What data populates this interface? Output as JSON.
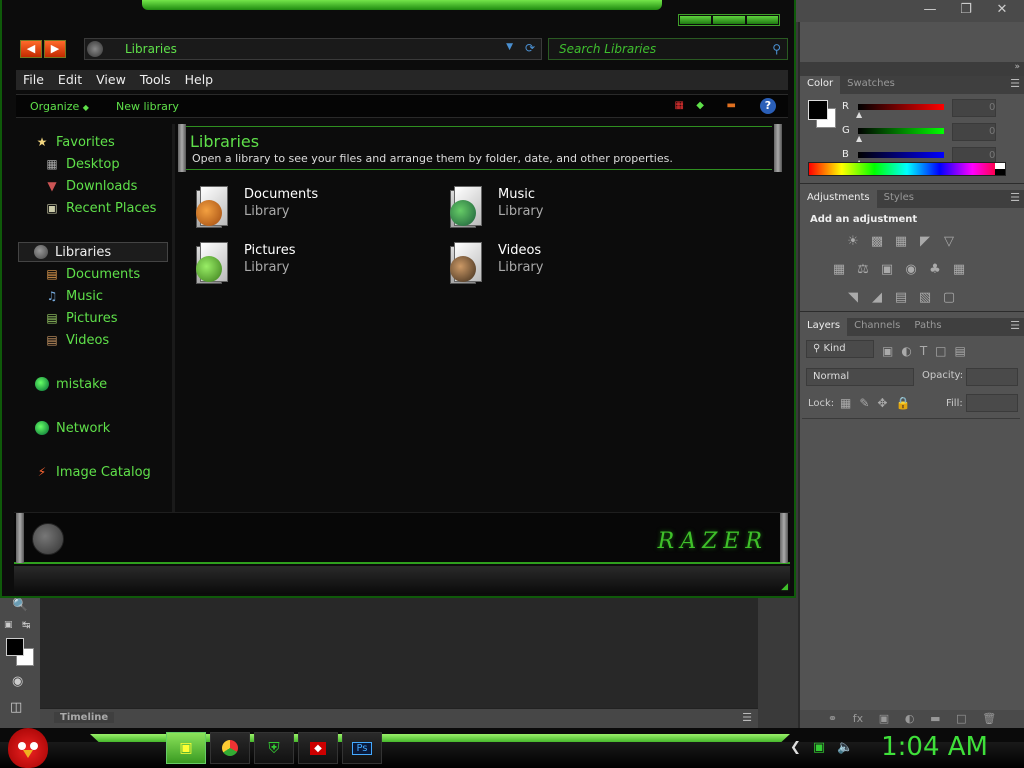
{
  "explorer": {
    "address": "Libraries",
    "search_placeholder": "Search Libraries",
    "menu": [
      "File",
      "Edit",
      "View",
      "Tools",
      "Help"
    ],
    "commands": {
      "organize": "Organize",
      "new_library": "New library"
    },
    "nav": {
      "favorites": "Favorites",
      "desktop": "Desktop",
      "downloads": "Downloads",
      "recent": "Recent Places",
      "libraries": "Libraries",
      "documents": "Documents",
      "music": "Music",
      "pictures": "Pictures",
      "videos": "Videos",
      "mistake": "mistake",
      "network": "Network",
      "image_catalog": "Image Catalog"
    },
    "content": {
      "title": "Libraries",
      "description": "Open a library to see your files and arrange them by folder, date, and other properties.",
      "items": [
        {
          "name": "Documents",
          "type": "Library"
        },
        {
          "name": "Music",
          "type": "Library"
        },
        {
          "name": "Pictures",
          "type": "Library"
        },
        {
          "name": "Videos",
          "type": "Library"
        }
      ]
    },
    "brand": "RAZER"
  },
  "photoshop": {
    "color_panel": {
      "tabs": [
        "Color",
        "Swatches"
      ],
      "r": "R",
      "g": "G",
      "b": "B",
      "r_val": "0",
      "g_val": "0",
      "b_val": "0"
    },
    "adjustments_panel": {
      "tabs": [
        "Adjustments",
        "Styles"
      ],
      "title": "Add an adjustment"
    },
    "layers_panel": {
      "tabs": [
        "Layers",
        "Channels",
        "Paths"
      ],
      "kind": "Kind",
      "blend": "Normal",
      "opacity_label": "Opacity:",
      "lock_label": "Lock:",
      "fill_label": "Fill:"
    },
    "timeline": "Timeline"
  },
  "taskbar": {
    "clock": "1:04 AM"
  },
  "colors": {
    "accent": "#5fe04a",
    "window_bg": "#0c0c0c",
    "ps_panel": "#535353"
  }
}
